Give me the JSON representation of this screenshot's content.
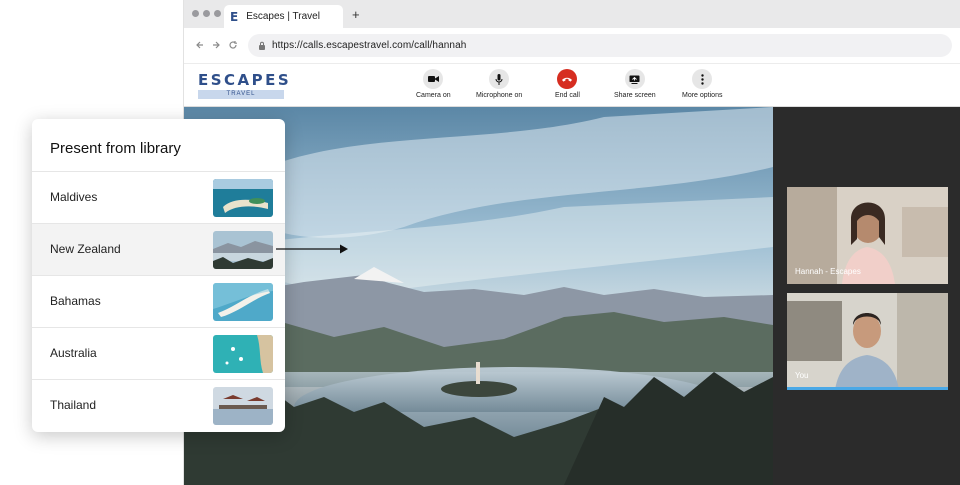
{
  "browser": {
    "tab_logo": "E",
    "tab_title": "Escapes | Travel",
    "new_tab": "+",
    "url": "https://calls.escapestravel.com/call/hannah"
  },
  "app": {
    "brand_name": "ESCAPES",
    "brand_sub": "TRAVEL",
    "controls": [
      {
        "label": "Camera on",
        "icon": "camera-icon"
      },
      {
        "label": "Microphone on",
        "icon": "microphone-icon"
      },
      {
        "label": "End call",
        "icon": "phone-hangup-icon"
      },
      {
        "label": "Share screen",
        "icon": "share-screen-icon"
      },
      {
        "label": "More options",
        "icon": "more-vertical-icon"
      }
    ],
    "end_call_color": "#d62d20"
  },
  "participants": [
    {
      "label": "Hannah - Escapes"
    },
    {
      "label": "You",
      "speaking": true
    }
  ],
  "library": {
    "title": "Present from library",
    "items": [
      {
        "name": "Maldives"
      },
      {
        "name": "New Zealand",
        "selected": true
      },
      {
        "name": "Bahamas"
      },
      {
        "name": "Australia"
      },
      {
        "name": "Thailand"
      }
    ]
  }
}
